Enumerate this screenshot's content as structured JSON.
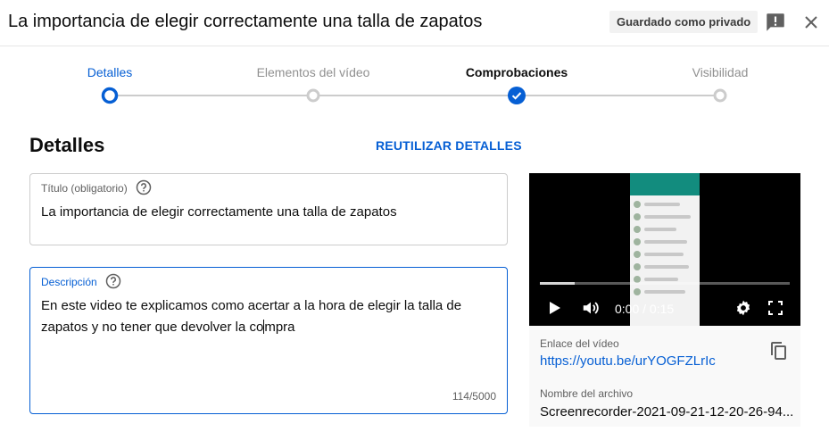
{
  "header": {
    "title": "La importancia de elegir correctamente una talla de zapatos",
    "saved_status": "Guardado como privado",
    "feedback_icon": "feedback-icon",
    "close_icon": "close-icon"
  },
  "stepper": {
    "steps": [
      {
        "label": "Detalles",
        "state": "active"
      },
      {
        "label": "Elementos del vídeo",
        "state": "todo"
      },
      {
        "label": "Comprobaciones",
        "state": "done"
      },
      {
        "label": "Visibilidad",
        "state": "todo"
      }
    ]
  },
  "details": {
    "heading": "Detalles",
    "reuse_label": "REUTILIZAR DETALLES",
    "title_field": {
      "label": "Título (obligatorio)",
      "value": "La importancia de elegir correctamente una talla de zapatos"
    },
    "description_field": {
      "label": "Descripción",
      "value_before_caret": "En este video te explicamos como acertar a la hora de elegir la talla de zapatos y no tener que devolver la co",
      "value_after_caret": "mpra",
      "counter": "114/5000"
    }
  },
  "video": {
    "time": "0:00 / 0:15",
    "progress": 0.14,
    "link_label": "Enlace del vídeo",
    "link": "https://youtu.be/urYOGFZLrIc",
    "file_label": "Nombre del archivo",
    "file_name": "Screenrecorder-2021-09-21-12-20-26-94..."
  },
  "colors": {
    "accent": "#065fd4",
    "text": "#0d0d0d",
    "secondary_text": "#606060",
    "muted_step": "#909090"
  }
}
